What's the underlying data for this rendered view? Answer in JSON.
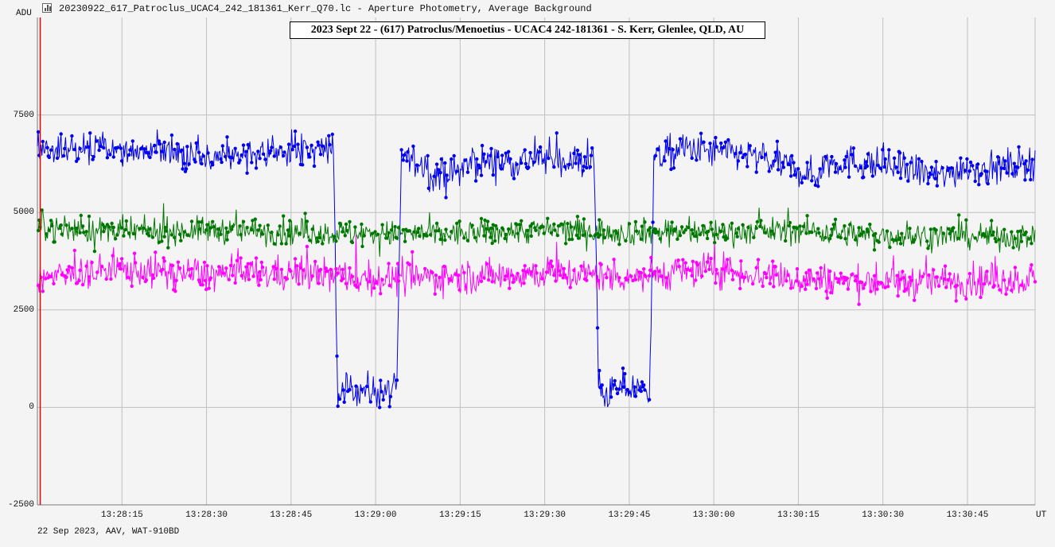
{
  "window": {
    "title": "20230922_617_Patroclus_UCAC4_242_181361_Kerr_Q70.lc - Aperture Photometry, Average Background",
    "icon": "light-curve-icon"
  },
  "footer": "22 Sep 2023, AAV, WAT-910BD",
  "colors": {
    "background": "#f4f4f4",
    "grid": "#c0c0c0",
    "target": "#0000ee",
    "comparison": "#007700",
    "background_star": "#ff00ff",
    "cursor": "#e00000"
  },
  "chart_data": {
    "type": "line",
    "title": "2023 Sept 22 - (617) Patroclus/Menoetius - UCAC4 242-181361 - S. Kerr, Glenlee, QLD, AU",
    "ylabel": "ADU",
    "xlabel": "UT",
    "ylim": [
      -2500,
      10000
    ],
    "xlim": [
      "13:28:00",
      "13:30:57"
    ],
    "grid": true,
    "y_ticks": [
      "-2500",
      "0",
      "2500",
      "5000",
      "7500"
    ],
    "y_tick_values": [
      -2500,
      0,
      2500,
      5000,
      7500
    ],
    "x_ticks": [
      "13:28:15",
      "13:28:30",
      "13:28:45",
      "13:29:00",
      "13:29:15",
      "13:29:30",
      "13:29:45",
      "13:30:00",
      "13:30:15",
      "13:30:30",
      "13:30:45"
    ],
    "x_tick_seconds": [
      15,
      30,
      45,
      60,
      75,
      90,
      105,
      120,
      135,
      150,
      165
    ],
    "cursor_x_seconds": 0.5,
    "series": [
      {
        "color": "#0000ee",
        "noise": 380,
        "anchors": [
          [
            0,
            6600
          ],
          [
            10,
            6650
          ],
          [
            20,
            6550
          ],
          [
            30,
            6400
          ],
          [
            40,
            6450
          ],
          [
            50,
            6650
          ],
          [
            52.5,
            6600
          ],
          [
            53.3,
            300
          ],
          [
            56,
            500
          ],
          [
            60,
            400
          ],
          [
            63.8,
            450
          ],
          [
            64.6,
            6500
          ],
          [
            68,
            6200
          ],
          [
            72,
            5900
          ],
          [
            78,
            6300
          ],
          [
            85,
            6300
          ],
          [
            90,
            6400
          ],
          [
            95,
            6300
          ],
          [
            98.8,
            6300
          ],
          [
            99.6,
            300
          ],
          [
            104,
            500
          ],
          [
            108,
            400
          ],
          [
            108.6,
            450
          ],
          [
            109.4,
            6400
          ],
          [
            115,
            6650
          ],
          [
            120,
            6550
          ],
          [
            125,
            6500
          ],
          [
            130,
            6300
          ],
          [
            135,
            6100
          ],
          [
            138,
            5900
          ],
          [
            140,
            6300
          ],
          [
            145,
            6300
          ],
          [
            150,
            6200
          ],
          [
            155,
            6100
          ],
          [
            160,
            5900
          ],
          [
            165,
            6200
          ],
          [
            168,
            6100
          ],
          [
            177,
            6300
          ]
        ]
      },
      {
        "color": "#007700",
        "noise": 300,
        "anchors": [
          [
            0,
            4600
          ],
          [
            15,
            4500
          ],
          [
            30,
            4550
          ],
          [
            45,
            4500
          ],
          [
            60,
            4450
          ],
          [
            75,
            4450
          ],
          [
            90,
            4550
          ],
          [
            105,
            4500
          ],
          [
            120,
            4500
          ],
          [
            135,
            4550
          ],
          [
            150,
            4400
          ],
          [
            165,
            4400
          ],
          [
            177,
            4350
          ]
        ]
      },
      {
        "color": "#ff00ff",
        "noise": 380,
        "anchors": [
          [
            0,
            3300
          ],
          [
            15,
            3550
          ],
          [
            30,
            3400
          ],
          [
            45,
            3450
          ],
          [
            60,
            3300
          ],
          [
            75,
            3350
          ],
          [
            90,
            3450
          ],
          [
            105,
            3350
          ],
          [
            120,
            3550
          ],
          [
            135,
            3300
          ],
          [
            150,
            3200
          ],
          [
            165,
            3250
          ],
          [
            177,
            3300
          ]
        ]
      }
    ]
  }
}
